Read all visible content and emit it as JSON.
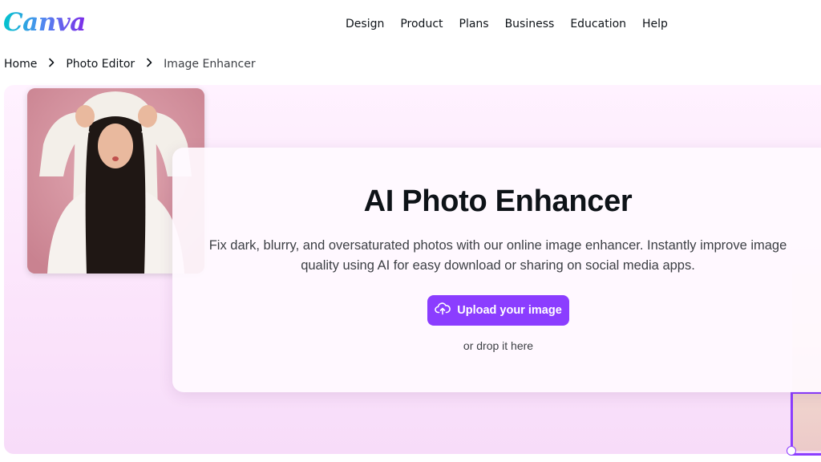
{
  "header": {
    "logo_text": "Canva",
    "nav": [
      {
        "label": "Design"
      },
      {
        "label": "Product"
      },
      {
        "label": "Plans"
      },
      {
        "label": "Business"
      },
      {
        "label": "Education"
      },
      {
        "label": "Help"
      }
    ]
  },
  "breadcrumb": {
    "items": [
      {
        "label": "Home"
      },
      {
        "label": "Photo Editor"
      },
      {
        "label": "Image Enhancer"
      }
    ],
    "separator_icon": "chevron-right-icon"
  },
  "hero": {
    "title": "AI Photo Enhancer",
    "description": "Fix dark, blurry, and oversaturated photos with our online image enhancer. Instantly improve image quality using AI for easy download or sharing on social media apps.",
    "upload_button_label": "Upload your image",
    "upload_icon": "cloud-upload-icon",
    "drop_text": "or drop it here",
    "photo_description": "woman in white fuzzy hooded jacket making peace signs on pink background"
  },
  "colors": {
    "brand_purple": "#8b3dff",
    "hero_bg": "#fbe4fb",
    "text_primary": "#0e1318",
    "text_secondary": "#3c3f44"
  }
}
